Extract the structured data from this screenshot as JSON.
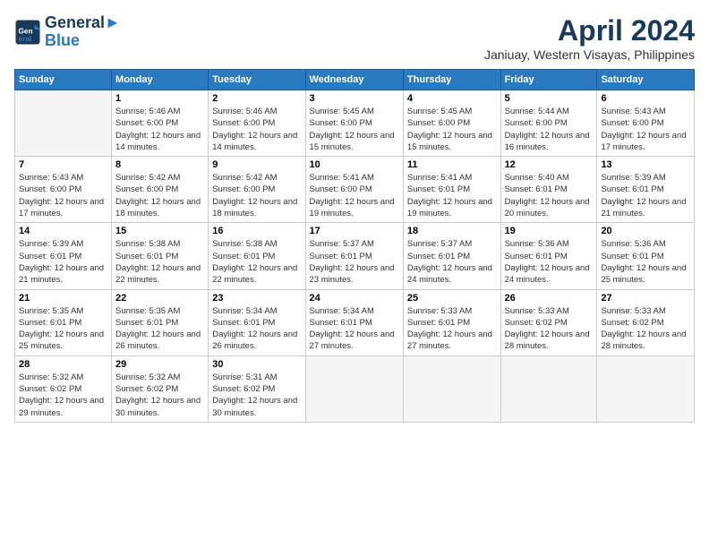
{
  "header": {
    "logo_line1": "General",
    "logo_line2": "Blue",
    "month_year": "April 2024",
    "location": "Janiuay, Western Visayas, Philippines"
  },
  "days_of_week": [
    "Sunday",
    "Monday",
    "Tuesday",
    "Wednesday",
    "Thursday",
    "Friday",
    "Saturday"
  ],
  "weeks": [
    [
      {
        "num": "",
        "empty": true
      },
      {
        "num": "1",
        "sunrise": "Sunrise: 5:46 AM",
        "sunset": "Sunset: 6:00 PM",
        "daylight": "Daylight: 12 hours and 14 minutes."
      },
      {
        "num": "2",
        "sunrise": "Sunrise: 5:46 AM",
        "sunset": "Sunset: 6:00 PM",
        "daylight": "Daylight: 12 hours and 14 minutes."
      },
      {
        "num": "3",
        "sunrise": "Sunrise: 5:45 AM",
        "sunset": "Sunset: 6:00 PM",
        "daylight": "Daylight: 12 hours and 15 minutes."
      },
      {
        "num": "4",
        "sunrise": "Sunrise: 5:45 AM",
        "sunset": "Sunset: 6:00 PM",
        "daylight": "Daylight: 12 hours and 15 minutes."
      },
      {
        "num": "5",
        "sunrise": "Sunrise: 5:44 AM",
        "sunset": "Sunset: 6:00 PM",
        "daylight": "Daylight: 12 hours and 16 minutes."
      },
      {
        "num": "6",
        "sunrise": "Sunrise: 5:43 AM",
        "sunset": "Sunset: 6:00 PM",
        "daylight": "Daylight: 12 hours and 17 minutes."
      }
    ],
    [
      {
        "num": "7",
        "sunrise": "Sunrise: 5:43 AM",
        "sunset": "Sunset: 6:00 PM",
        "daylight": "Daylight: 12 hours and 17 minutes."
      },
      {
        "num": "8",
        "sunrise": "Sunrise: 5:42 AM",
        "sunset": "Sunset: 6:00 PM",
        "daylight": "Daylight: 12 hours and 18 minutes."
      },
      {
        "num": "9",
        "sunrise": "Sunrise: 5:42 AM",
        "sunset": "Sunset: 6:00 PM",
        "daylight": "Daylight: 12 hours and 18 minutes."
      },
      {
        "num": "10",
        "sunrise": "Sunrise: 5:41 AM",
        "sunset": "Sunset: 6:00 PM",
        "daylight": "Daylight: 12 hours and 19 minutes."
      },
      {
        "num": "11",
        "sunrise": "Sunrise: 5:41 AM",
        "sunset": "Sunset: 6:01 PM",
        "daylight": "Daylight: 12 hours and 19 minutes."
      },
      {
        "num": "12",
        "sunrise": "Sunrise: 5:40 AM",
        "sunset": "Sunset: 6:01 PM",
        "daylight": "Daylight: 12 hours and 20 minutes."
      },
      {
        "num": "13",
        "sunrise": "Sunrise: 5:39 AM",
        "sunset": "Sunset: 6:01 PM",
        "daylight": "Daylight: 12 hours and 21 minutes."
      }
    ],
    [
      {
        "num": "14",
        "sunrise": "Sunrise: 5:39 AM",
        "sunset": "Sunset: 6:01 PM",
        "daylight": "Daylight: 12 hours and 21 minutes."
      },
      {
        "num": "15",
        "sunrise": "Sunrise: 5:38 AM",
        "sunset": "Sunset: 6:01 PM",
        "daylight": "Daylight: 12 hours and 22 minutes."
      },
      {
        "num": "16",
        "sunrise": "Sunrise: 5:38 AM",
        "sunset": "Sunset: 6:01 PM",
        "daylight": "Daylight: 12 hours and 22 minutes."
      },
      {
        "num": "17",
        "sunrise": "Sunrise: 5:37 AM",
        "sunset": "Sunset: 6:01 PM",
        "daylight": "Daylight: 12 hours and 23 minutes."
      },
      {
        "num": "18",
        "sunrise": "Sunrise: 5:37 AM",
        "sunset": "Sunset: 6:01 PM",
        "daylight": "Daylight: 12 hours and 24 minutes."
      },
      {
        "num": "19",
        "sunrise": "Sunrise: 5:36 AM",
        "sunset": "Sunset: 6:01 PM",
        "daylight": "Daylight: 12 hours and 24 minutes."
      },
      {
        "num": "20",
        "sunrise": "Sunrise: 5:36 AM",
        "sunset": "Sunset: 6:01 PM",
        "daylight": "Daylight: 12 hours and 25 minutes."
      }
    ],
    [
      {
        "num": "21",
        "sunrise": "Sunrise: 5:35 AM",
        "sunset": "Sunset: 6:01 PM",
        "daylight": "Daylight: 12 hours and 25 minutes."
      },
      {
        "num": "22",
        "sunrise": "Sunrise: 5:35 AM",
        "sunset": "Sunset: 6:01 PM",
        "daylight": "Daylight: 12 hours and 26 minutes."
      },
      {
        "num": "23",
        "sunrise": "Sunrise: 5:34 AM",
        "sunset": "Sunset: 6:01 PM",
        "daylight": "Daylight: 12 hours and 26 minutes."
      },
      {
        "num": "24",
        "sunrise": "Sunrise: 5:34 AM",
        "sunset": "Sunset: 6:01 PM",
        "daylight": "Daylight: 12 hours and 27 minutes."
      },
      {
        "num": "25",
        "sunrise": "Sunrise: 5:33 AM",
        "sunset": "Sunset: 6:01 PM",
        "daylight": "Daylight: 12 hours and 27 minutes."
      },
      {
        "num": "26",
        "sunrise": "Sunrise: 5:33 AM",
        "sunset": "Sunset: 6:02 PM",
        "daylight": "Daylight: 12 hours and 28 minutes."
      },
      {
        "num": "27",
        "sunrise": "Sunrise: 5:33 AM",
        "sunset": "Sunset: 6:02 PM",
        "daylight": "Daylight: 12 hours and 28 minutes."
      }
    ],
    [
      {
        "num": "28",
        "sunrise": "Sunrise: 5:32 AM",
        "sunset": "Sunset: 6:02 PM",
        "daylight": "Daylight: 12 hours and 29 minutes."
      },
      {
        "num": "29",
        "sunrise": "Sunrise: 5:32 AM",
        "sunset": "Sunset: 6:02 PM",
        "daylight": "Daylight: 12 hours and 30 minutes."
      },
      {
        "num": "30",
        "sunrise": "Sunrise: 5:31 AM",
        "sunset": "Sunset: 6:02 PM",
        "daylight": "Daylight: 12 hours and 30 minutes."
      },
      {
        "num": "",
        "empty": true
      },
      {
        "num": "",
        "empty": true
      },
      {
        "num": "",
        "empty": true
      },
      {
        "num": "",
        "empty": true
      }
    ]
  ]
}
